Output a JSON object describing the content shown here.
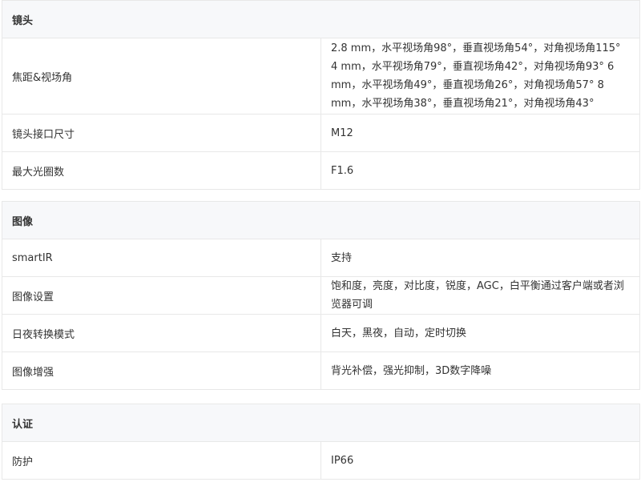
{
  "sections": [
    {
      "title": "镜头",
      "rows": [
        {
          "label": "焦距&视场角",
          "value": "2.8 mm，水平视场角98°，垂直视场角54°，对角视场角115° 4 mm，水平视场角79°，垂直视场角42°，对角视场角93° 6 mm，水平视场角49°，垂直视场角26°，对角视场角57° 8 mm，水平视场角38°，垂直视场角21°，对角视场角43°"
        },
        {
          "label": "镜头接口尺寸",
          "value": "M12"
        },
        {
          "label": "最大光圈数",
          "value": "F1.6"
        }
      ]
    },
    {
      "title": "图像",
      "rows": [
        {
          "label": "smartIR",
          "value": "支持"
        },
        {
          "label": "图像设置",
          "value": "饱和度，亮度，对比度，锐度，AGC，白平衡通过客户端或者浏览器可调"
        },
        {
          "label": "日夜转换模式",
          "value": "白天，黑夜，自动，定时切换"
        },
        {
          "label": "图像增强",
          "value": "背光补偿，强光抑制，3D数字降噪"
        }
      ]
    },
    {
      "title": "认证",
      "rows": [
        {
          "label": "防护",
          "value": "IP66"
        }
      ]
    }
  ]
}
